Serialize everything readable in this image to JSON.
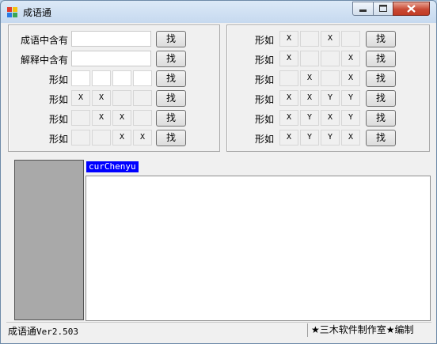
{
  "window": {
    "title": "成语通"
  },
  "left_rows": [
    {
      "label": "成语中含有",
      "type": "text",
      "value": "",
      "button": "找"
    },
    {
      "label": "解释中含有",
      "type": "text",
      "value": "",
      "button": "找"
    },
    {
      "label": "形如",
      "type": "cells",
      "cells": [
        "",
        "",
        "",
        ""
      ],
      "button": "找"
    },
    {
      "label": "形如",
      "type": "cells",
      "cells": [
        "X",
        "X",
        "",
        ""
      ],
      "button": "找"
    },
    {
      "label": "形如",
      "type": "cells",
      "cells": [
        "",
        "X",
        "X",
        ""
      ],
      "button": "找"
    },
    {
      "label": "形如",
      "type": "cells",
      "cells": [
        "",
        "",
        "X",
        "X"
      ],
      "button": "找"
    }
  ],
  "right_rows": [
    {
      "label": "形如",
      "cells": [
        "X",
        "",
        "X",
        ""
      ],
      "button": "找"
    },
    {
      "label": "形如",
      "cells": [
        "X",
        "",
        "",
        "X"
      ],
      "button": "找"
    },
    {
      "label": "形如",
      "cells": [
        "",
        "X",
        "",
        "X"
      ],
      "button": "找"
    },
    {
      "label": "形如",
      "cells": [
        "X",
        "X",
        "Y",
        "Y"
      ],
      "button": "找"
    },
    {
      "label": "形如",
      "cells": [
        "X",
        "Y",
        "X",
        "Y"
      ],
      "button": "找"
    },
    {
      "label": "形如",
      "cells": [
        "X",
        "Y",
        "Y",
        "X"
      ],
      "button": "找"
    }
  ],
  "current_tag": "curChenyu",
  "content_text": "",
  "status": {
    "app_name": "成语通",
    "version": "Ver2.503",
    "credit": "★三木软件制作室★编制"
  },
  "colors": {
    "tag_bg": "#0000ff",
    "side_panel": "#a9a9a9"
  }
}
